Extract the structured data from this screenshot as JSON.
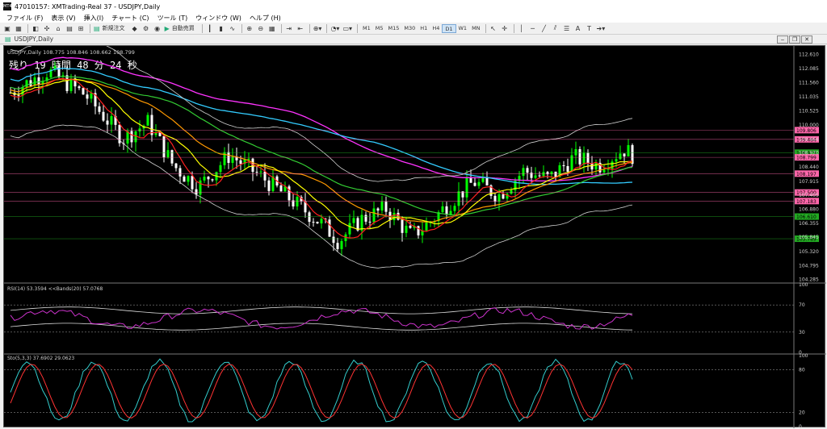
{
  "window": {
    "title": "47010157: XMTrading-Real 37 - USDJPY,Daily",
    "icon_label": "MT4"
  },
  "menu": [
    "ファイル (F)",
    "表示 (V)",
    "挿入(I)",
    "チャート (C)",
    "ツール (T)",
    "ウィンドウ (W)",
    "ヘルプ (H)"
  ],
  "toolbar": {
    "new_order": "新規注文",
    "auto_trading": "自動売買",
    "timeframes": [
      "M1",
      "M5",
      "M15",
      "M30",
      "H1",
      "H4",
      "D1",
      "W1",
      "MN"
    ],
    "active_timeframe": "D1"
  },
  "chart_window": {
    "title": "USDJPY,Daily",
    "info": "USDJPY,Daily  108.775 108.846 108.662 108.799",
    "countdown": "残り 19 時間 48 分 24 秒"
  },
  "colors": {
    "up_candle": "#00ff00",
    "down_candle": "#ffffff",
    "ma_red": "#ff2020",
    "ma_orange": "#ff9900",
    "ma_yellow": "#ffff00",
    "ma_green": "#33cc33",
    "ma_magenta": "#ff33ff",
    "ma_cyan": "#33ccff",
    "bands": "#d0d0d0"
  },
  "main_axis": {
    "ticks": [
      "112.610",
      "112.085",
      "111.560",
      "111.035",
      "110.525",
      "110.000",
      "109.464",
      "108.970",
      "108.440",
      "107.915",
      "107.405",
      "106.880",
      "106.355",
      "105.845",
      "105.320",
      "104.795",
      "104.285"
    ],
    "badges": [
      {
        "label": "109.806",
        "bg": "#ff66aa"
      },
      {
        "label": "109.464",
        "bg": "#ff66aa"
      },
      {
        "label": "108.973",
        "bg": "#22aa22"
      },
      {
        "label": "108.799",
        "bg": "#ff66aa"
      },
      {
        "label": "108.197",
        "bg": "#ff66aa"
      },
      {
        "label": "107.500",
        "bg": "#ff66aa"
      },
      {
        "label": "107.183",
        "bg": "#ff66aa"
      },
      {
        "label": "106.610",
        "bg": "#22aa22"
      },
      {
        "label": "105.789",
        "bg": "#22aa22"
      }
    ]
  },
  "rsi_panel": {
    "label": "RSI(14) 53.3594  <<Bands(20) 57.0768",
    "ticks": [
      "100",
      "70",
      "30",
      "0"
    ]
  },
  "stoch_panel": {
    "label": "Sto(5,3,3) 37.6902 29.0623",
    "ticks": [
      "100",
      "80",
      "20",
      "0"
    ]
  }
}
